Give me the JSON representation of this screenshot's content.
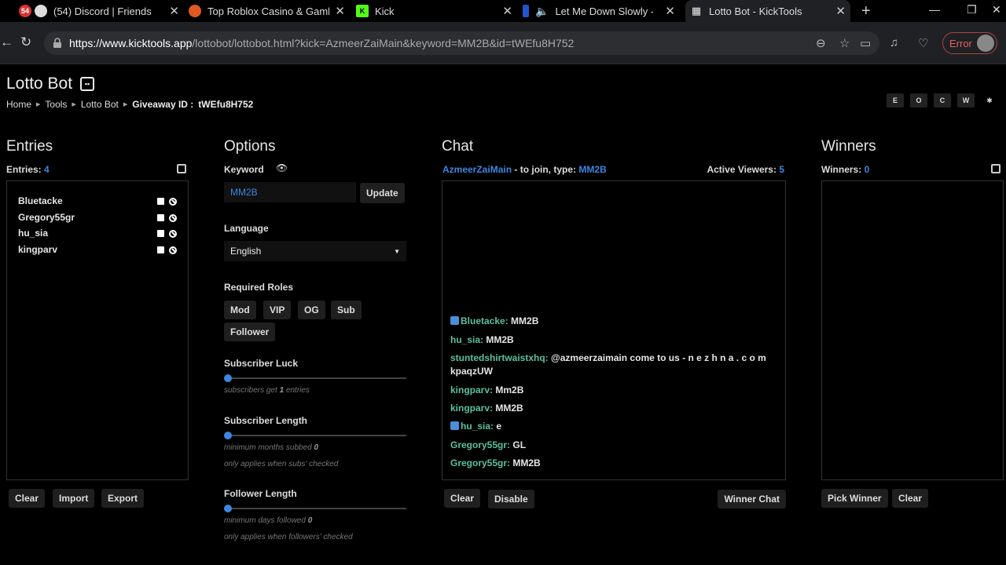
{
  "browser": {
    "tabs": [
      {
        "label": "(54) Discord | Friends",
        "badge": "54"
      },
      {
        "label": "Top Roblox Casino & Gambl"
      },
      {
        "label": "Kick"
      },
      {
        "label": "Let Me Down Slowly - A"
      },
      {
        "label": "Lotto Bot - KickTools",
        "active": true
      }
    ],
    "url_host": "https://www.kicktools.app",
    "url_path": "/lottobot/lottobot.html?kick=AzmeerZaiMain&keyword=MM2B&id=tWEfu8H752",
    "error_label": "Error"
  },
  "page": {
    "title": "Lotto Bot",
    "breadcrumb": {
      "home": "Home",
      "tools": "Tools",
      "lotto": "Lotto Bot",
      "giveaway_label": "Giveaway ID :",
      "giveaway_id": "tWEfu8H752"
    },
    "theme_buttons": [
      "E",
      "O",
      "C",
      "W",
      "✱"
    ]
  },
  "entries": {
    "heading": "Entries",
    "count_label": "Entries:",
    "count": "4",
    "items": [
      "Bluetacke",
      "Gregory55gr",
      "hu_sia",
      "kingparv"
    ],
    "buttons": {
      "clear": "Clear",
      "import": "Import",
      "export": "Export"
    }
  },
  "options": {
    "heading": "Options",
    "keyword_label": "Keyword",
    "keyword_value": "MM2B",
    "update": "Update",
    "language_label": "Language",
    "language_value": "English",
    "roles_label": "Required Roles",
    "roles": [
      "Mod",
      "VIP",
      "OG",
      "Sub",
      "Follower"
    ],
    "sub_luck_label": "Subscriber Luck",
    "sub_luck_hint_pre": "subscribers get",
    "sub_luck_value": "1",
    "sub_luck_hint_post": "entries",
    "sub_length_label": "Subscriber Length",
    "sub_length_hint": "minimum months subbed",
    "sub_length_value": "0",
    "sub_length_note": "only applies when subs' checked",
    "fol_length_label": "Follower Length",
    "fol_length_hint": "minimum days followed",
    "fol_length_value": "0",
    "fol_length_note": "only applies when followers' checked"
  },
  "chat": {
    "heading": "Chat",
    "channel": "AzmeerZaiMain",
    "join_text": " - to join, type: ",
    "keyword": "MM2B",
    "viewers_label": "Active Viewers:",
    "viewers": "5",
    "messages": [
      {
        "user": "Bluetacke:",
        "text": " MM2B",
        "badge": true
      },
      {
        "user": "hu_sia:",
        "text": " MM2B"
      },
      {
        "user": "stuntedshirtwaistxhq:",
        "text": " @azmeerzaimain come to us - n e z h n a . c o m kpaqzUW"
      },
      {
        "user": "kingparv:",
        "text": " Mm2B"
      },
      {
        "user": "kingparv:",
        "text": " MM2B"
      },
      {
        "user": "hu_sia:",
        "text": " e",
        "badge": true
      },
      {
        "user": "Gregory55gr:",
        "text": " GL"
      },
      {
        "user": "Gregory55gr:",
        "text": " MM2B"
      }
    ],
    "buttons": {
      "clear": "Clear",
      "disable": "Disable",
      "winner_chat": "Winner Chat"
    }
  },
  "winners": {
    "heading": "Winners",
    "count_label": "Winners:",
    "count": "0",
    "buttons": {
      "pick": "Pick Winner",
      "clear": "Clear"
    }
  }
}
